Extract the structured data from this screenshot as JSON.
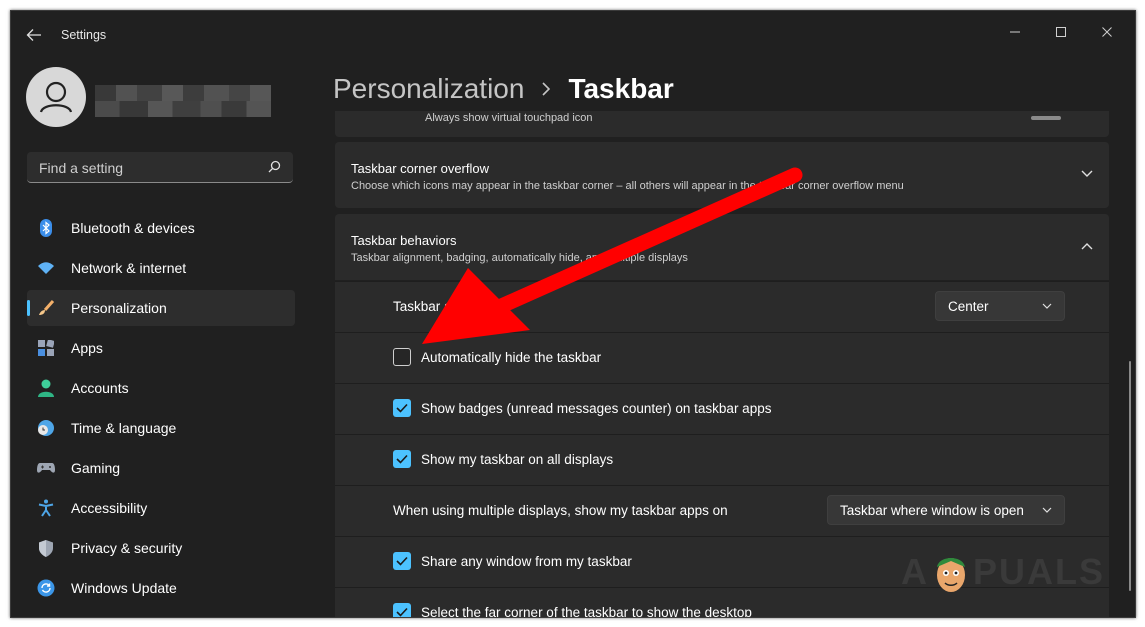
{
  "window": {
    "title": "Settings"
  },
  "account": {
    "name": ""
  },
  "search": {
    "placeholder": "Find a setting"
  },
  "sidebar": {
    "items": [
      {
        "label": "Bluetooth & devices",
        "icon": "bluetooth-icon"
      },
      {
        "label": "Network & internet",
        "icon": "wifi-icon"
      },
      {
        "label": "Personalization",
        "icon": "brush-icon",
        "active": true
      },
      {
        "label": "Apps",
        "icon": "apps-icon"
      },
      {
        "label": "Accounts",
        "icon": "person-icon"
      },
      {
        "label": "Time & language",
        "icon": "globe-clock-icon"
      },
      {
        "label": "Gaming",
        "icon": "gamepad-icon"
      },
      {
        "label": "Accessibility",
        "icon": "accessibility-icon"
      },
      {
        "label": "Privacy & security",
        "icon": "shield-icon"
      },
      {
        "label": "Windows Update",
        "icon": "update-icon"
      }
    ]
  },
  "breadcrumb": {
    "parent": "Personalization",
    "current": "Taskbar"
  },
  "partial_row": {
    "label": "Always show virtual touchpad icon"
  },
  "overflow_card": {
    "title": "Taskbar corner overflow",
    "description": "Choose which icons may appear in the taskbar corner – all others will appear in the taskbar corner overflow menu"
  },
  "behaviors_card": {
    "title": "Taskbar behaviors",
    "description": "Taskbar alignment, badging, automatically hide, and multiple displays"
  },
  "settings": {
    "alignment": {
      "label": "Taskbar alignment",
      "value": "Center"
    },
    "auto_hide": {
      "label": "Automatically hide the taskbar",
      "checked": false
    },
    "badges": {
      "label": "Show badges (unread messages counter) on taskbar apps",
      "checked": true
    },
    "all_displays": {
      "label": "Show my taskbar on all displays",
      "checked": true
    },
    "multi_display": {
      "label": "When using multiple displays, show my taskbar apps on",
      "value": "Taskbar where window is open"
    },
    "share_window": {
      "label": "Share any window from my taskbar",
      "checked": true
    },
    "far_corner": {
      "label": "Select the far corner of the taskbar to show the desktop",
      "checked": true
    }
  },
  "watermark": {
    "text_left": "A",
    "text_right": "PUALS"
  },
  "colors": {
    "accent": "#4cc2ff",
    "background": "#202020",
    "card": "#2b2b2b",
    "arrow": "#ff0000"
  }
}
